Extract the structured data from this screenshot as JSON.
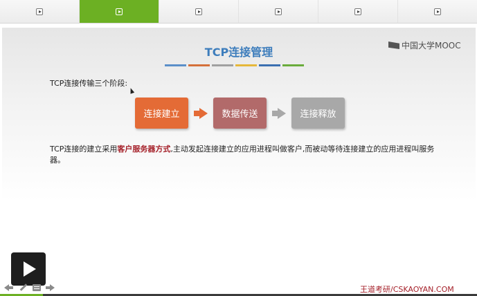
{
  "tabs": [
    {
      "name": "tab-1",
      "active": false
    },
    {
      "name": "tab-2",
      "active": true
    },
    {
      "name": "tab-3",
      "active": false
    },
    {
      "name": "tab-4",
      "active": false
    },
    {
      "name": "tab-5",
      "active": false
    },
    {
      "name": "tab-6",
      "active": false
    }
  ],
  "slide": {
    "title": "TCP连接管理",
    "title_color": "#3d7dbc",
    "color_bars": [
      "#5b8fc9",
      "#d4703a",
      "#a0a0a0",
      "#e6b83a",
      "#3b6fb0",
      "#6aac3c"
    ],
    "logo_text": "中国大学MOOC",
    "intro": "TCP连接传输三个阶段:",
    "stages": [
      {
        "label": "连接建立",
        "color": "#e46b36"
      },
      {
        "label": "数据传送",
        "color": "#b26a6a"
      },
      {
        "label": "连接释放",
        "color": "#a8a8a8"
      }
    ],
    "paragraph": {
      "before": "TCP连接的建立采用",
      "highlight": "客户服务器方式",
      "after": ",主动发起连接建立的应用进程叫做客户,而被动等待连接建立的应用进程叫服务器。"
    }
  },
  "player": {
    "watermark": "王道考研/CSKAOYAN.COM",
    "progress": 0.09
  }
}
